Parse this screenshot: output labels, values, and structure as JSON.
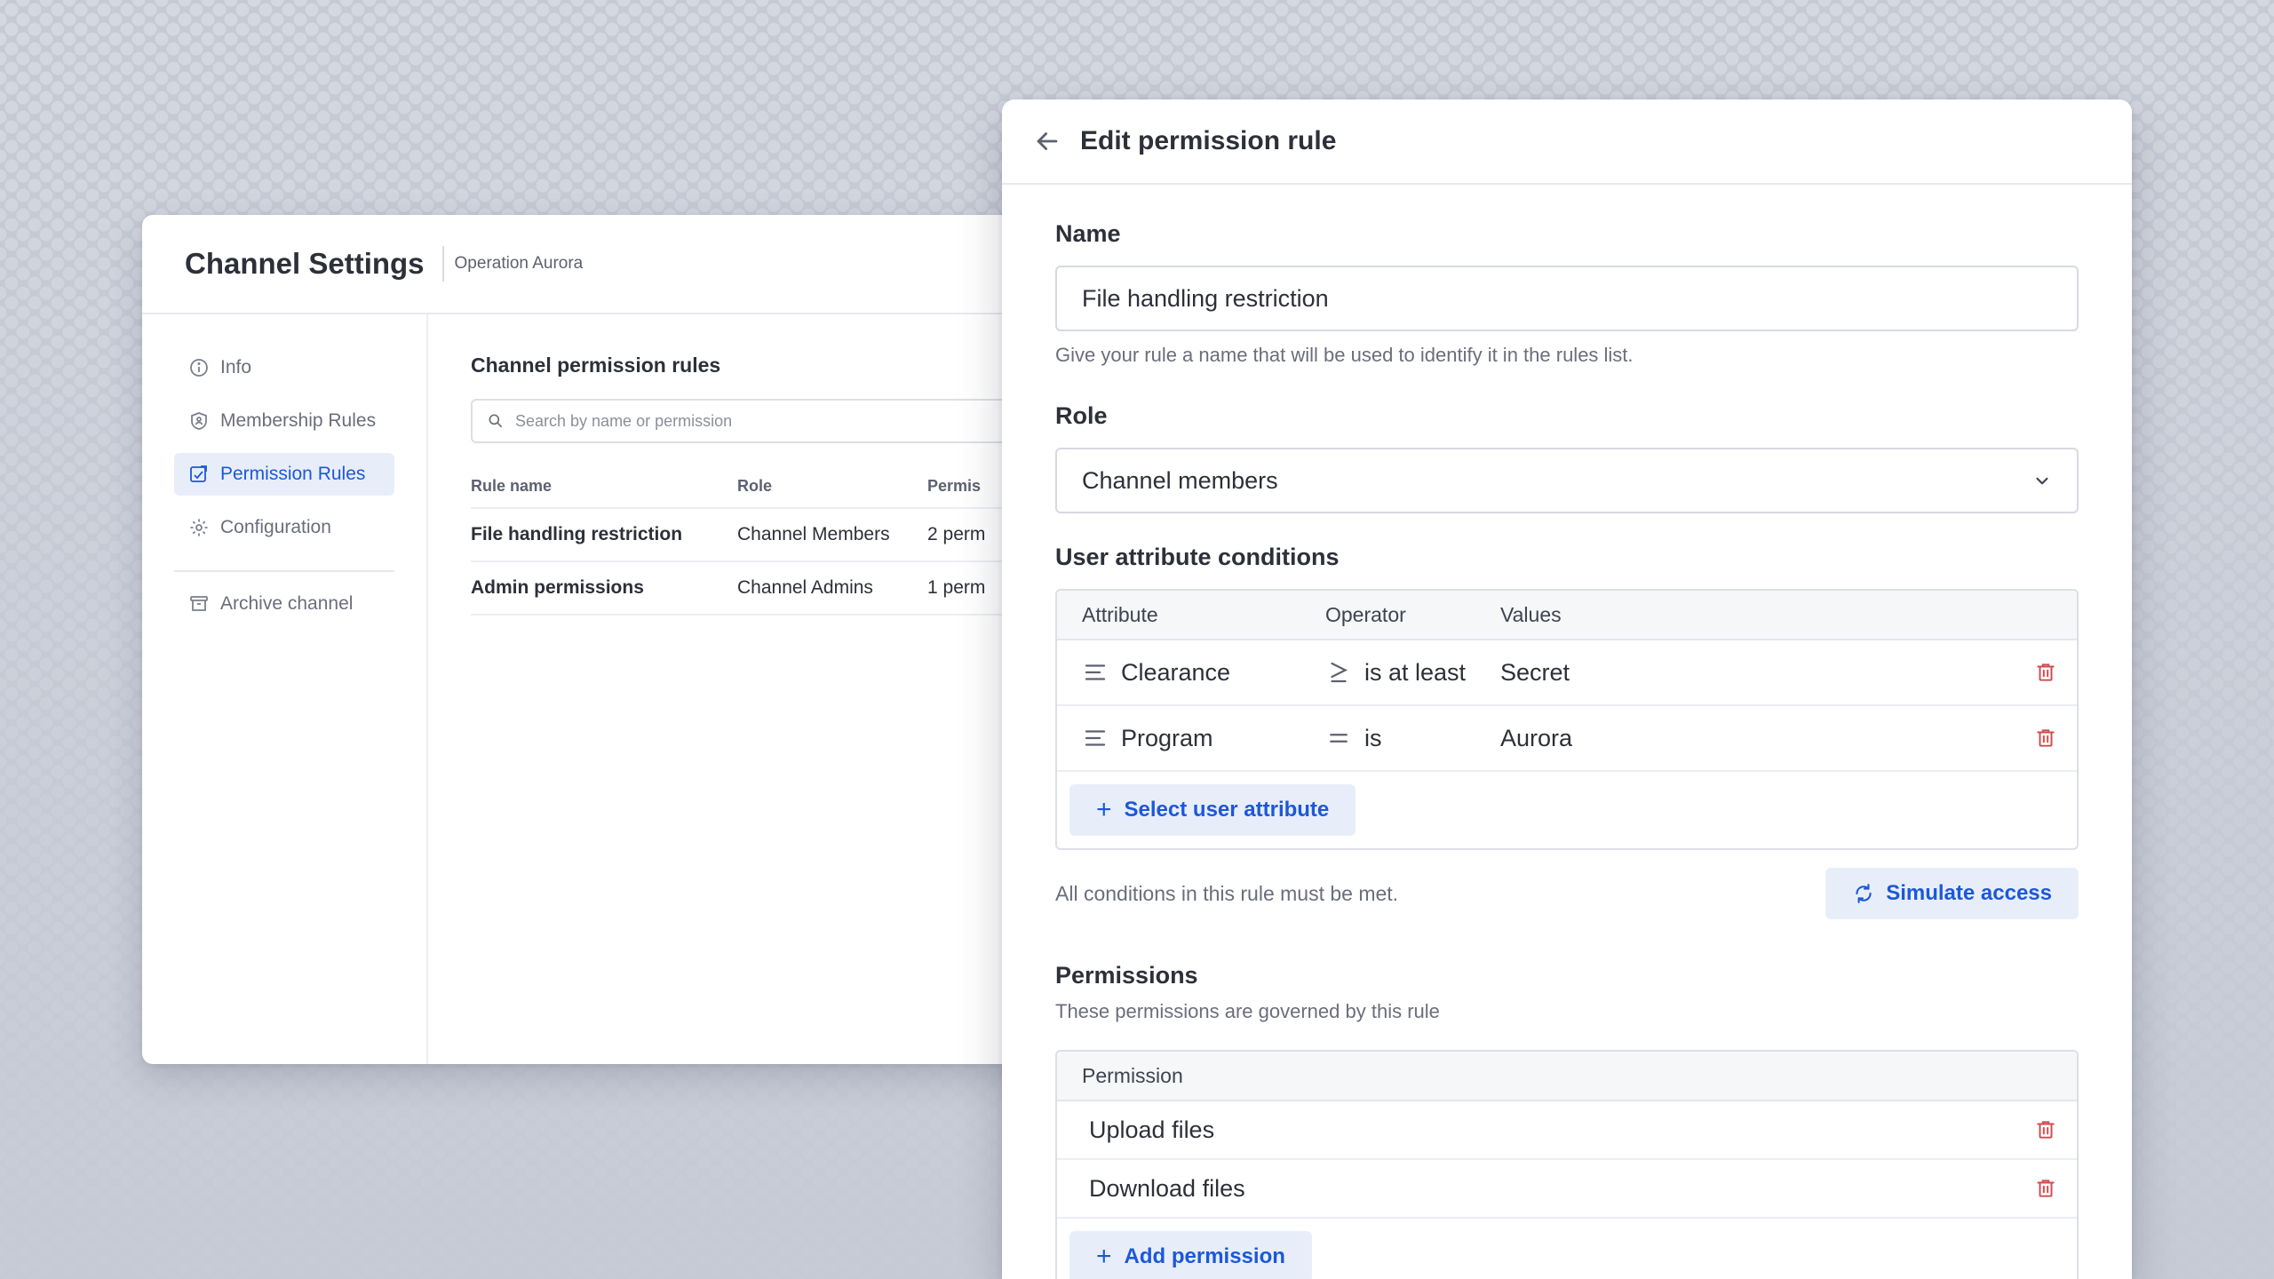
{
  "channel_settings": {
    "title": "Channel Settings",
    "subtitle": "Operation Aurora",
    "nav": {
      "info": "Info",
      "membership_rules": "Membership Rules",
      "permission_rules": "Permission Rules",
      "configuration": "Configuration",
      "archive": "Archive channel"
    },
    "active_nav": "Permission Rules",
    "section_title": "Channel permission rules",
    "search_placeholder": "Search by name or permission",
    "columns": {
      "name": "Rule name",
      "role": "Role",
      "permissions": "Permis"
    },
    "rows": [
      {
        "name": "File handling restriction",
        "role": "Channel Members",
        "permissions": "2 perm"
      },
      {
        "name": "Admin permissions",
        "role": "Channel Admins",
        "permissions": "1 perm"
      }
    ]
  },
  "edit_rule": {
    "title": "Edit permission rule",
    "name_label": "Name",
    "name_value": "File handling restriction",
    "name_help": "Give your rule a name that will be used to identify it in the rules list.",
    "role_label": "Role",
    "role_value": "Channel members",
    "conditions_label": "User attribute conditions",
    "conditions_columns": {
      "attribute": "Attribute",
      "operator": "Operator",
      "values": "Values"
    },
    "conditions": [
      {
        "attribute": "Clearance",
        "operator_symbol": "≥",
        "operator": "is at least",
        "value": "Secret"
      },
      {
        "attribute": "Program",
        "operator_symbol": "=",
        "operator": "is",
        "value": "Aurora"
      }
    ],
    "select_attribute_label": "Select user attribute",
    "conditions_note": "All conditions in this rule must be met.",
    "simulate_label": "Simulate access",
    "permissions_label": "Permissions",
    "permissions_help": "These permissions are governed by this rule",
    "permissions_column": "Permission",
    "permissions": [
      {
        "name": "Upload files"
      },
      {
        "name": "Download files"
      }
    ],
    "add_permission_label": "Add permission"
  },
  "colors": {
    "accent": "#1c58d9",
    "accent_bg": "#e8eef9",
    "danger": "#d24b4e",
    "background": "#c6cad5"
  }
}
